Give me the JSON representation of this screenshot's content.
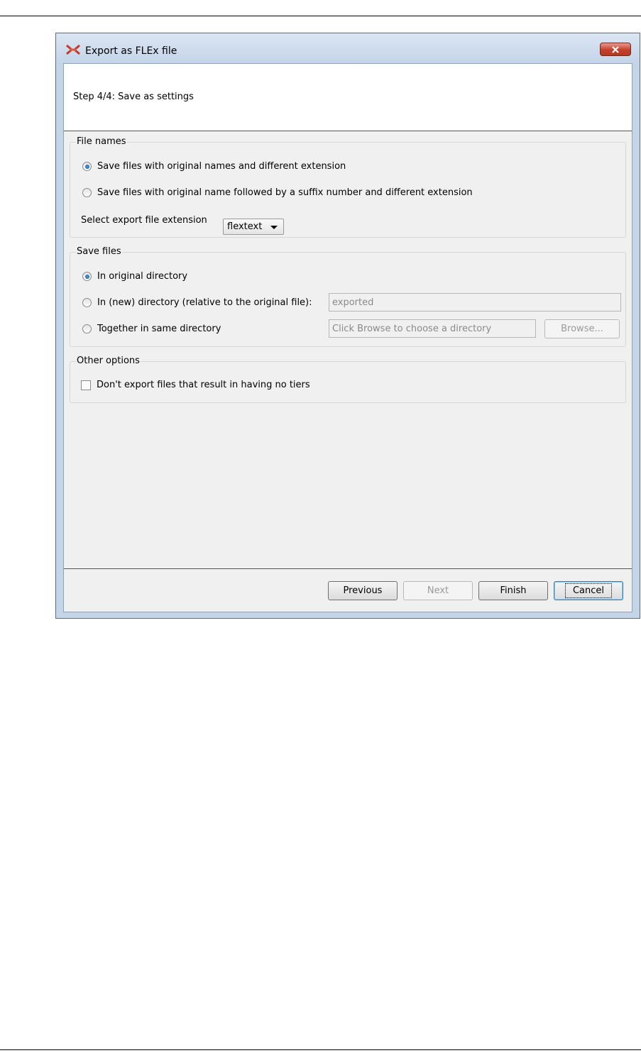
{
  "window": {
    "title": "Export as FLEx file",
    "app_icon": "elan-x-icon",
    "close_icon": "close-icon"
  },
  "header": {
    "step_label": "Step 4/4: Save as settings"
  },
  "file_names": {
    "title": "File names",
    "option_original": "Save files with original names and different extension",
    "option_suffix": "Save files with original name followed by a suffix number and different extension",
    "selected_option": "option_original",
    "extension_label": "Select export file extension",
    "extension_value": "flextext"
  },
  "save_files": {
    "title": "Save files",
    "option_original_dir": "In original directory",
    "option_new_dir": "In (new) directory (relative to the original file):",
    "option_same_dir": "Together in same directory",
    "selected_option": "option_original_dir",
    "new_dir_value": "exported",
    "same_dir_value": "Click Browse to choose a directory",
    "browse_label": "Browse..."
  },
  "other_options": {
    "title": "Other options",
    "no_tiers_label": "Don't export files that result in having no tiers",
    "no_tiers_checked": false
  },
  "footer": {
    "previous_label": "Previous",
    "next_label": "Next",
    "finish_label": "Finish",
    "cancel_label": "Cancel"
  },
  "colors": {
    "title_bar": "#c4d4e8",
    "close_button": "#c4402b",
    "dialog_background": "#f0f0f0"
  }
}
